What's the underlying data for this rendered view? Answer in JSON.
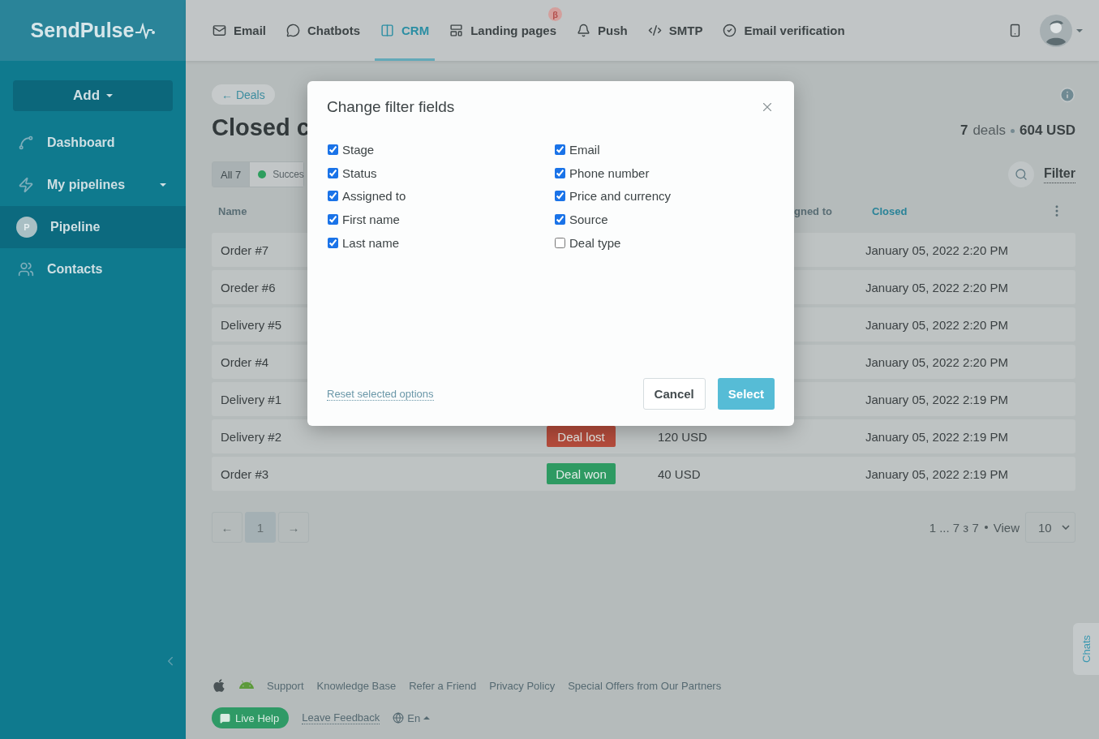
{
  "sidebar": {
    "logo": "SendPulse",
    "add_button": "Add",
    "items": [
      {
        "label": "Dashboard",
        "selected": false
      },
      {
        "label": "My pipelines",
        "selected": false,
        "expanded": false
      },
      {
        "label": "Pipeline",
        "selected": true,
        "avatar": "P"
      },
      {
        "label": "Contacts",
        "selected": false
      }
    ]
  },
  "top_nav": {
    "items": [
      {
        "label": "Email",
        "selected": false
      },
      {
        "label": "Chatbots",
        "selected": false
      },
      {
        "label": "CRM",
        "selected": true
      },
      {
        "label": "Landing pages",
        "selected": false,
        "badge": "β"
      },
      {
        "label": "Push",
        "selected": false
      },
      {
        "label": "SMTP",
        "selected": false
      },
      {
        "label": "Email verification",
        "selected": false
      }
    ]
  },
  "page": {
    "back_link": "← Deals",
    "title": "Closed c",
    "summary": {
      "count": "7",
      "unit": "deals",
      "total": "604 USD"
    },
    "filter_tabs": [
      {
        "label": "All",
        "count": "7",
        "selected": true
      },
      {
        "label": "Succes",
        "selected": false,
        "color": "#2e9e5e"
      }
    ],
    "filter_button": "Filter"
  },
  "table": {
    "columns": [
      {
        "label": "Name",
        "selected": false
      },
      {
        "label": "gned to",
        "selected": false
      },
      {
        "label": "Closed",
        "selected": true
      }
    ],
    "rows": [
      {
        "name": "Order #7",
        "closed": "January 05, 2022 2:20 PM"
      },
      {
        "name": "Oreder #6",
        "closed": "January 05, 2022 2:20 PM"
      },
      {
        "name": "Delivery #5",
        "closed": "January 05, 2022 2:20 PM"
      },
      {
        "name": "Order #4",
        "closed": "January 05, 2022 2:20 PM"
      },
      {
        "name": "Delivery #1",
        "closed": "January 05, 2022 2:19 PM"
      },
      {
        "name": "Delivery #2",
        "status": {
          "label": "Deal lost",
          "color": "#b44c3c"
        },
        "price": "120 USD",
        "closed": "January 05, 2022 2:19 PM"
      },
      {
        "name": "Order #3",
        "status": {
          "label": "Deal won",
          "color": "#2e9a62"
        },
        "price": "40 USD",
        "closed": "January 05, 2022 2:19 PM"
      }
    ]
  },
  "pagination": {
    "prev": "←",
    "pages": [
      {
        "label": "1",
        "selected": true
      }
    ],
    "next": "→",
    "range": "1 ... 7 з 7",
    "view_label": "View",
    "page_size": "10"
  },
  "footer": {
    "links": [
      "Support",
      "Knowledge Base",
      "Refer a Friend",
      "Privacy Policy",
      "Special Offers from Our Partners"
    ],
    "live_help": "Live Help",
    "feedback": "Leave Feedback",
    "language": "En"
  },
  "chats_tab": "Chats",
  "modal": {
    "title": "Change filter fields",
    "fields": [
      {
        "label": "Stage",
        "checked": true
      },
      {
        "label": "Status",
        "checked": true
      },
      {
        "label": "Assigned to",
        "checked": true
      },
      {
        "label": "First name",
        "checked": true
      },
      {
        "label": "Last name",
        "checked": true
      },
      {
        "label": "Email",
        "checked": true
      },
      {
        "label": "Phone number",
        "checked": true
      },
      {
        "label": "Price and currency",
        "checked": true
      },
      {
        "label": "Source",
        "checked": true
      },
      {
        "label": "Deal type",
        "checked": false
      }
    ],
    "reset_link": "Reset selected options",
    "cancel_button": "Cancel",
    "select_button": "Select"
  }
}
